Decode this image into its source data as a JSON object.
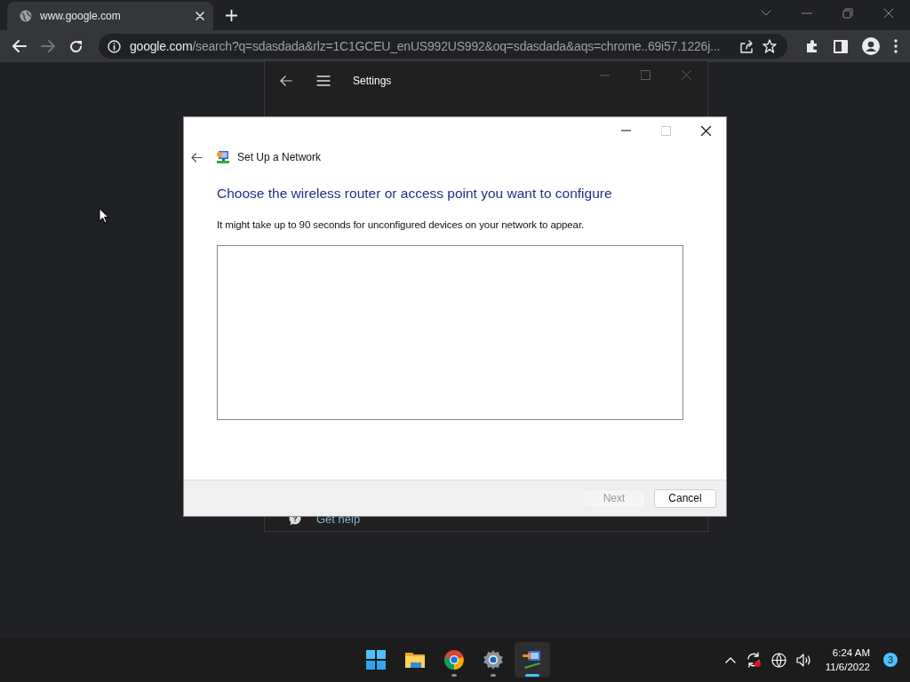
{
  "browser": {
    "tab": {
      "title": "www.google.com",
      "selected": true
    },
    "address": {
      "host": "google.com",
      "path": "/search?q=sdasdada&rlz=1C1GCEU_enUS992US992&oq=sdasdada&aqs=chrome..69i57.1226j..."
    },
    "forward_disabled": true
  },
  "settings_window": {
    "title": "Settings",
    "help_link": "Get help"
  },
  "dialog": {
    "title": "Set Up a Network",
    "heading": "Choose the wireless router or access point you want to configure",
    "description": "It might take up to 90 seconds for unconfigured devices on your network to appear.",
    "buttons": [
      {
        "label": "Next",
        "disabled": true
      },
      {
        "label": "Cancel",
        "disabled": false
      }
    ]
  },
  "taskbar": {
    "apps": [
      {
        "kind": "start",
        "running": false,
        "active": false
      },
      {
        "kind": "folder",
        "running": false,
        "active": false
      },
      {
        "kind": "chrome",
        "running": true,
        "active": false
      },
      {
        "kind": "settings",
        "running": true,
        "active": false
      },
      {
        "kind": "network",
        "running": true,
        "active": true
      }
    ],
    "time": "6:24 AM",
    "date": "11/6/2022",
    "notifications": "3"
  }
}
